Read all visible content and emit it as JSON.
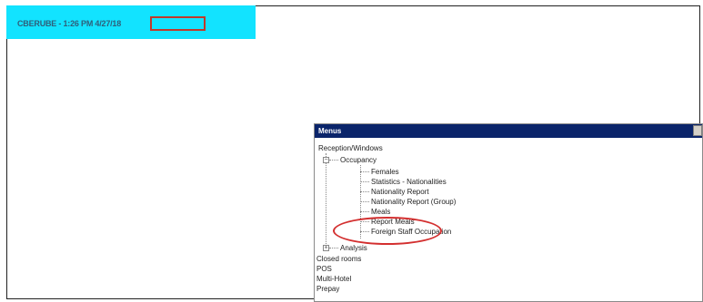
{
  "caption": {
    "text": "CBERUBE - 1:26 PM 4/27/18"
  },
  "menus_window": {
    "title": "Menus",
    "tree": {
      "root": "Reception/Windows",
      "occupancy": "Occupancy",
      "occupancy_children": [
        "Females",
        "Statistics - Nationalities",
        "Nationality Report",
        "Nationality Report (Group)",
        "Meals",
        "Report Meals",
        "Foreign Staff Occupation"
      ],
      "analysis": "Analysis",
      "top_level": [
        "Closed rooms",
        "POS",
        "Multi-Hotel",
        "Prepay"
      ]
    }
  },
  "colors": {
    "caption_bar": "#12e3ff",
    "annotation_red": "#d32f2f",
    "titlebar": "#0a246a"
  }
}
